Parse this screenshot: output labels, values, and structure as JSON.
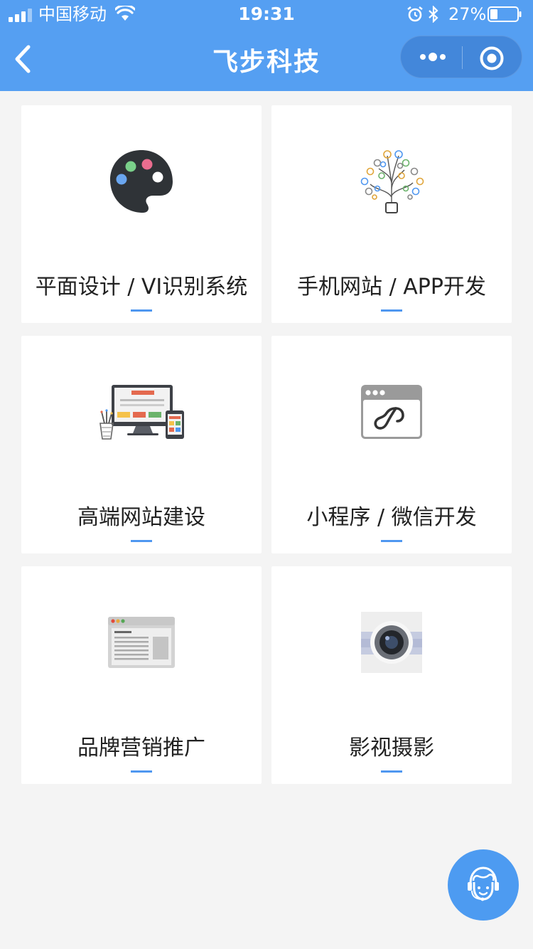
{
  "status_bar": {
    "carrier": "中国移动",
    "time": "19:31",
    "battery": "27%",
    "icons": [
      "signal-icon",
      "wifi-icon",
      "alarm-icon",
      "bluetooth-icon",
      "battery-icon"
    ]
  },
  "nav": {
    "title": "飞步科技",
    "back_icon": "back-chevron-icon",
    "menu_icon": "more-icon",
    "close_icon": "target-icon"
  },
  "services": [
    {
      "label": "平面设计 / VI识别系统",
      "icon": "palette-icon"
    },
    {
      "label": "手机网站 / APP开发",
      "icon": "tree-apps-icon"
    },
    {
      "label": "高端网站建设",
      "icon": "devices-icon"
    },
    {
      "label": "小程序 / 微信开发",
      "icon": "mini-program-icon"
    },
    {
      "label": "品牌营销推广",
      "icon": "webpage-icon"
    },
    {
      "label": "影视摄影",
      "icon": "camera-icon"
    }
  ],
  "floating": {
    "icon": "customer-service-icon"
  },
  "colors": {
    "nav_bg": "#559ff2",
    "accent": "#4f97f0",
    "page_bg": "#f4f4f4",
    "card_bg": "#ffffff"
  }
}
